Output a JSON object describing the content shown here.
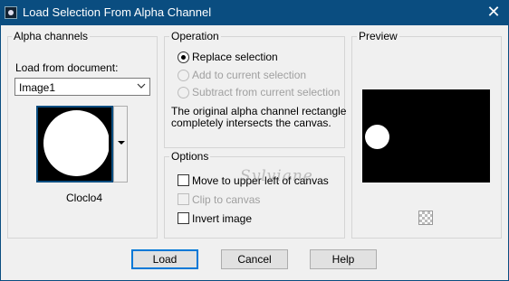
{
  "window": {
    "title": "Load Selection From Alpha Channel",
    "close_glyph": "✕"
  },
  "alpha": {
    "group_label": "Alpha channels",
    "load_from_label": "Load from document:",
    "document_value": "Image1",
    "channel_name": "Cloclo4"
  },
  "operation": {
    "group_label": "Operation",
    "options": [
      {
        "label": "Replace selection",
        "selected": true,
        "enabled": true
      },
      {
        "label": "Add to current selection",
        "selected": false,
        "enabled": false
      },
      {
        "label": "Subtract from current selection",
        "selected": false,
        "enabled": false
      }
    ],
    "info_line1": "The original alpha channel rectangle",
    "info_line2": "completely intersects the canvas."
  },
  "options": {
    "group_label": "Options",
    "items": [
      {
        "label": "Move to upper left of canvas",
        "checked": false,
        "enabled": true
      },
      {
        "label": "Clip to canvas",
        "checked": false,
        "enabled": false
      },
      {
        "label": "Invert image",
        "checked": false,
        "enabled": true
      }
    ]
  },
  "preview": {
    "group_label": "Preview",
    "background_icon": "checkerboard-icon"
  },
  "watermark": "Sylviane",
  "buttons": {
    "load": "Load",
    "cancel": "Cancel",
    "help": "Help"
  },
  "colors": {
    "titlebar": "#0a4d80",
    "accent": "#0078d7"
  }
}
